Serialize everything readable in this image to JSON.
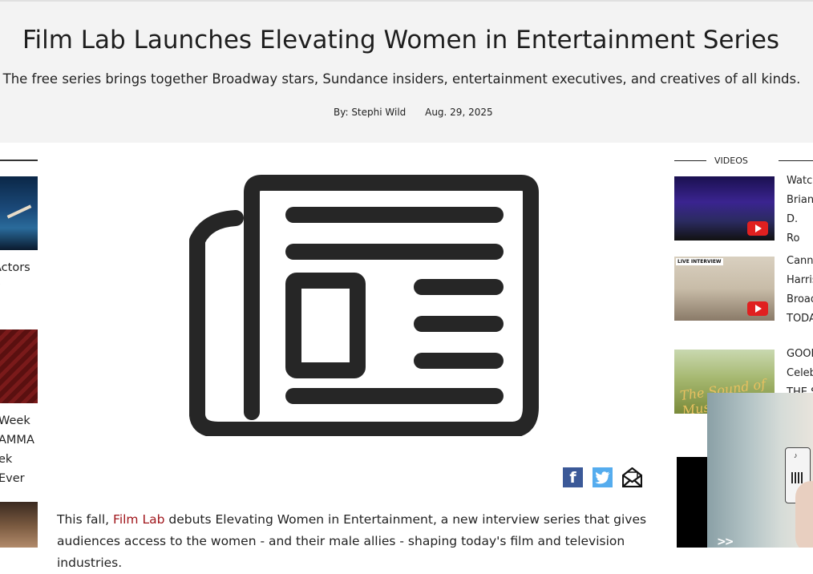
{
  "article": {
    "title": "Film Lab Launches Elevating Women in Entertainment Series",
    "subtitle": "The free series brings together Broadway stars, Sundance insiders, entertainment executives, and creatives of all kinds.",
    "byline": "By: Stephi Wild",
    "date": "Aug. 29, 2025",
    "body_prefix": "This fall, ",
    "body_link": "Film Lab",
    "body_rest": " debuts Elevating Women in Entertainment, a new interview series that gives audiences access to the women - and their male allies - shaping today's film and television industries."
  },
  "share": {
    "facebook_icon": "facebook-icon",
    "twitter_icon": "twitter-icon",
    "email_icon": "email-icon",
    "fb_glyph": "f"
  },
  "left_rail": {
    "item1_text": "Actors\ny",
    "item2_text": "Week\nAMMA\nek Ever"
  },
  "videos": {
    "heading": "VIDEOS",
    "items": [
      {
        "caption": "Watc\nBrian\nD. Ro",
        "live_tag": ""
      },
      {
        "caption": "Cann\nHarris\nBroad\nTODA",
        "live_tag": "LIVE INTERVIEW"
      },
      {
        "caption": "GOOD\nCeleb\nTHE S",
        "thumb_text": "The Sound of Music"
      }
    ]
  },
  "overlay": {
    "arrows": ">>"
  },
  "colors": {
    "header_bg": "#f3f3f3",
    "link": "#a0161c",
    "facebook": "#3b5998",
    "twitter": "#55acee",
    "youtube_red": "#e02020"
  }
}
